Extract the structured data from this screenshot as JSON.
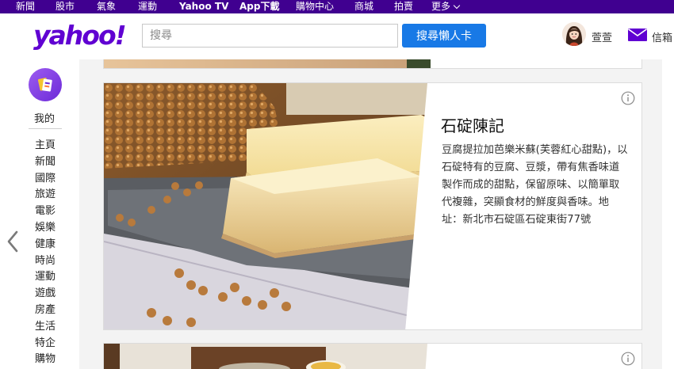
{
  "topnav": {
    "items": [
      "新聞",
      "股市",
      "氣象",
      "運動",
      "Yahoo TV",
      "App下載",
      "購物中心",
      "商城",
      "拍賣",
      "更多"
    ]
  },
  "header": {
    "logo": "yahoo!",
    "search_placeholder": "搜尋",
    "search_button": "搜尋懶人卡",
    "username": "萱萱",
    "mail_label": "信箱"
  },
  "sidebar": {
    "mine_label": "我的",
    "items": [
      "主頁",
      "新聞",
      "國際",
      "旅遊",
      "電影",
      "娛樂",
      "健康",
      "時尚",
      "運動",
      "遊戲",
      "房產",
      "生活",
      "特企",
      "購物"
    ]
  },
  "card": {
    "title": "石碇陳記",
    "description": "豆腐提拉加芭樂米蘇(芙蓉紅心甜點)，以石碇特有的豆腐、豆漿，帶有焦香味道製作而成的甜點，保留原味、以簡單取代複雜，突顯食材的鮮度與香味。地址：新北市石碇區石碇東街77號"
  },
  "colors": {
    "brand": "#6001d2",
    "topnav_bg": "#400090",
    "search_button": "#1879e6"
  },
  "icons": {
    "info": "info-icon",
    "mail": "mail-icon",
    "prev": "chevron-left-icon"
  }
}
